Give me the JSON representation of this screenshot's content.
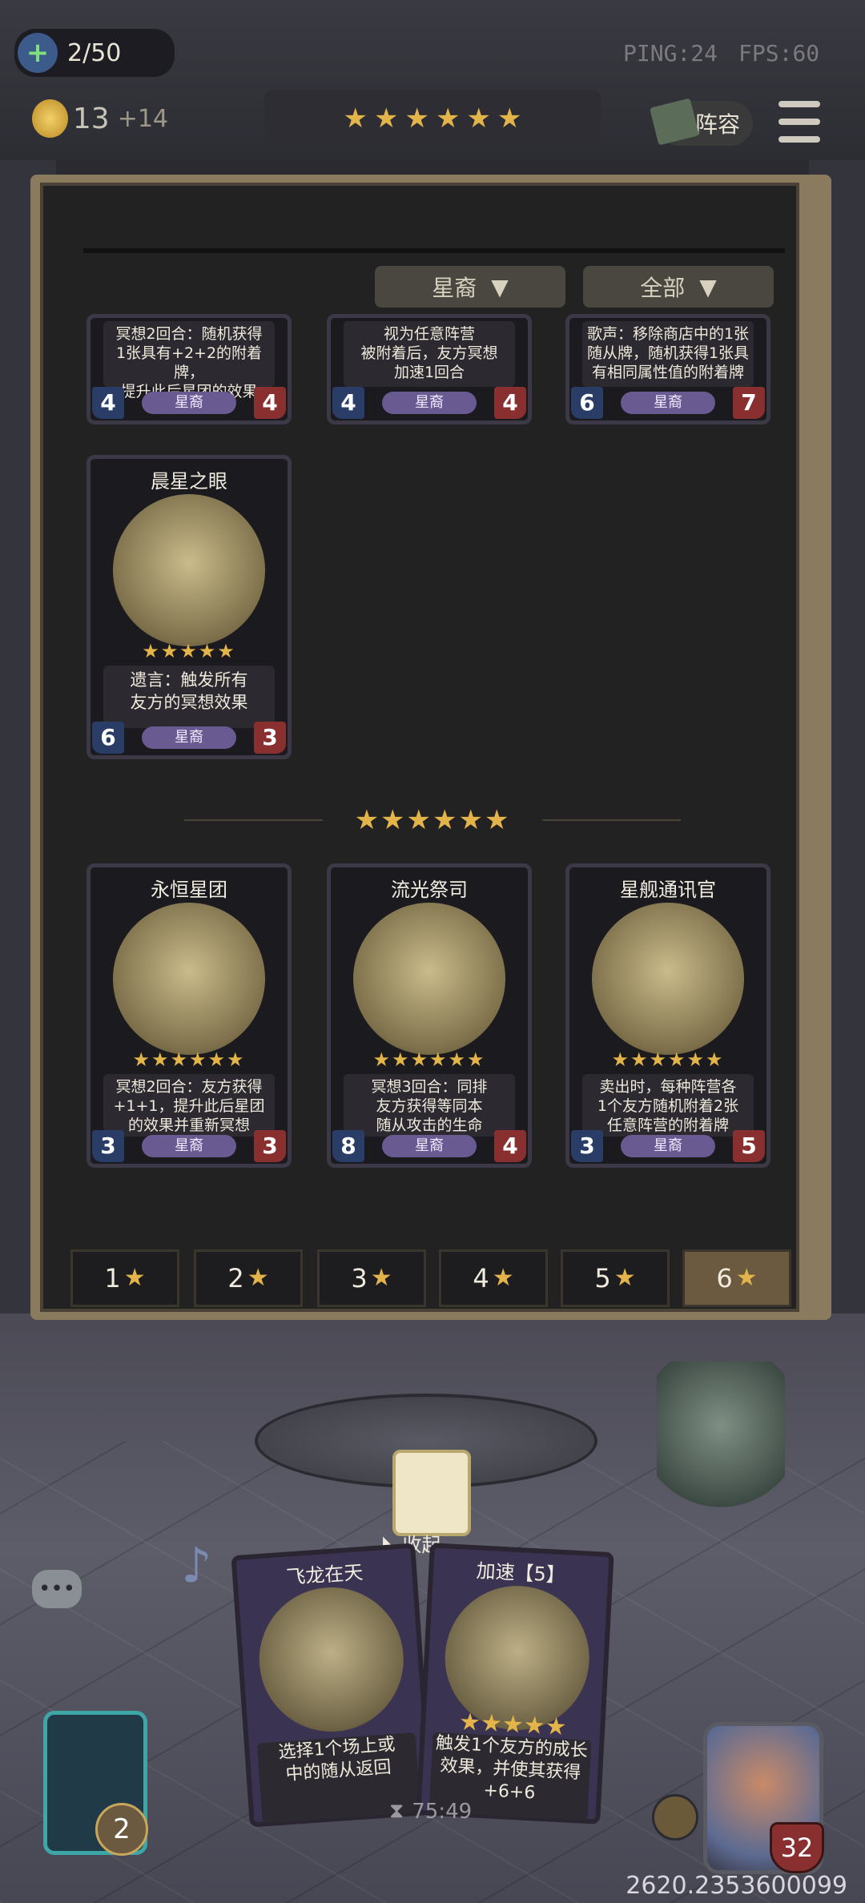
{
  "hud": {
    "population": "2/50",
    "gold": "13",
    "gold_income": "+14",
    "ping": "PING:24",
    "fps": "FPS:60",
    "lineup_label": "阵容"
  },
  "shop_stars": 6,
  "filters": {
    "tribe": "星裔",
    "scope": "全部"
  },
  "partial_cards": [
    {
      "desc_lines": [
        "冥想2回合：随机获得",
        "1张具有+2+2的附着牌，",
        "提升此后星团的效果"
      ],
      "tribe": "星裔",
      "atk": "4",
      "hp": "4"
    },
    {
      "desc_lines": [
        "视为任意阵营",
        "被附着后，友方冥想",
        "加速1回合"
      ],
      "tribe": "星裔",
      "atk": "4",
      "hp": "4"
    },
    {
      "desc_lines": [
        "歌声：移除商店中的1张",
        "随从牌，随机获得1张具",
        "有相同属性值的附着牌"
      ],
      "tribe": "星裔",
      "atk": "6",
      "hp": "7"
    }
  ],
  "five_star_card": {
    "name": "晨星之眼",
    "stars": "★★★★★",
    "desc_lines": [
      "遗言：触发所有",
      "友方的冥想效果"
    ],
    "tribe": "星裔",
    "atk": "6",
    "hp": "3"
  },
  "six_star_divider_stars": "★★★★★★",
  "six_star_cards": [
    {
      "name": "永恒星团",
      "stars": "★★★★★★",
      "desc_lines": [
        "冥想2回合：友方获得",
        "+1+1，提升此后星团",
        "的效果并重新冥想"
      ],
      "tribe": "星裔",
      "atk": "3",
      "hp": "3"
    },
    {
      "name": "流光祭司",
      "stars": "★★★★★★",
      "desc_lines": [
        "冥想3回合：同排",
        "友方获得等同本",
        "随从攻击的生命"
      ],
      "tribe": "星裔",
      "atk": "8",
      "hp": "4"
    },
    {
      "name": "星舰通讯官",
      "stars": "★★★★★★",
      "desc_lines": [
        "卖出时，每种阵营各",
        "1个友方随机附着2张",
        "任意阵营的附着牌"
      ],
      "tribe": "星裔",
      "atk": "3",
      "hp": "5"
    }
  ],
  "tiers": [
    "1",
    "2",
    "3",
    "4",
    "5",
    "6"
  ],
  "active_tier": "6",
  "collapse_label": "收起",
  "hand_cards": [
    {
      "name": "飞龙在天",
      "desc_lines": [
        "选择1个场上或",
        "中的随从返回"
      ]
    },
    {
      "name": "加速【5】",
      "stars": "★★★★★",
      "desc_lines": [
        "触发1个友方的成长",
        "效果，并使其获得",
        "+6+6"
      ]
    }
  ],
  "hero": {
    "level": "2",
    "health": "32"
  },
  "timer": "75:49",
  "debug_value": "2620.2353600099"
}
